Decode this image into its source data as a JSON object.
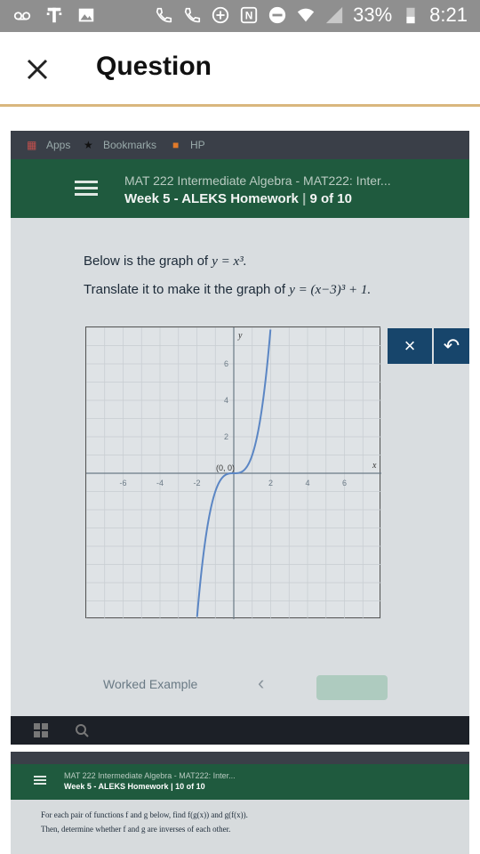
{
  "status_bar": {
    "battery": "33%",
    "time": "8:21",
    "left_icons": [
      "voicemail-icon",
      "t-mobile-icon",
      "gallery-icon"
    ],
    "right_icons": [
      "wifi-call-icon",
      "call-icon",
      "data-saver-icon",
      "nfc-icon",
      "dnd-icon",
      "wifi-icon",
      "signal-icon",
      "battery-icon"
    ]
  },
  "app_bar": {
    "title": "Question",
    "close_icon": "close-icon"
  },
  "photo": {
    "bookmarks_bar": {
      "apps": "Apps",
      "bookmarks": "Bookmarks",
      "hp": "HP"
    },
    "header": {
      "course": "MAT 222 Intermediate Algebra - MAT222: Inter...",
      "homework": "Week 5 - ALEKS Homework",
      "progress": "9 of 10"
    },
    "question": {
      "line1_prefix": "Below is the graph of ",
      "line1_math": "y = x³.",
      "line2_prefix": "Translate it to make it the graph of ",
      "line2_math": "y = (x−3)³ + 1."
    },
    "graph": {
      "y_axis_label": "y",
      "x_axis_label": "x",
      "point_label": "(0, 0)",
      "x_ticks": [
        "-6",
        "-4",
        "-2",
        "2",
        "4",
        "6"
      ],
      "y_ticks": [
        "6",
        "4",
        "2"
      ],
      "xlim": [
        -8,
        8
      ],
      "ylim": [
        -8,
        8
      ]
    },
    "buttons": {
      "x": "×",
      "undo": "↶"
    },
    "worked_example": "Worked Example",
    "nav_prev": "‹"
  },
  "photo2": {
    "header": {
      "course": "MAT 222 Intermediate Algebra - MAT222: Inter...",
      "homework": "Week 5 - ALEKS Homework",
      "progress": "10 of 10"
    },
    "line1": "For each pair of functions f and g below, find f(g(x)) and g(f(x)).",
    "line2": "Then, determine whether f and g are inverses of each other."
  },
  "colors": {
    "status_bar": "#8f8f8f",
    "aleks_green": "#1f5a3e",
    "button_blue": "#17456b",
    "curve_blue": "#5b86c4",
    "appbar_border": "#d9b77e"
  }
}
